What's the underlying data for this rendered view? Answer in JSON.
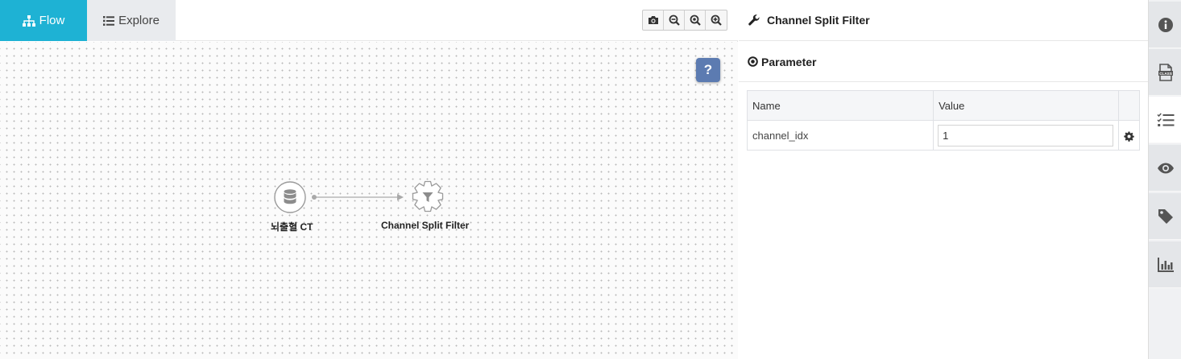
{
  "tabs": [
    {
      "label": "Flow",
      "icon": "sitemap-icon",
      "active": true
    },
    {
      "label": "Explore",
      "icon": "list-icon",
      "active": false
    }
  ],
  "toolbar": {
    "buttons": [
      "camera-icon",
      "zoom-out-icon",
      "zoom-fit-icon",
      "zoom-in-icon"
    ]
  },
  "canvas": {
    "help_label": "?",
    "nodes": [
      {
        "label": "뇌출혈 CT",
        "icon": "database-icon"
      },
      {
        "label": "Channel Split Filter",
        "icon": "filter-gear-icon"
      }
    ]
  },
  "panel": {
    "title": "Channel Split Filter",
    "section": "Parameter",
    "columns": [
      "Name",
      "Value"
    ],
    "params": [
      {
        "name": "channel_idx",
        "value": "1"
      }
    ]
  },
  "sidebar": {
    "buttons": [
      "info-icon",
      "class-file-icon",
      "checklist-icon",
      "eye-icon",
      "tag-icon",
      "bar-chart-icon"
    ],
    "active_index": 2
  },
  "colors": {
    "accent": "#1eb2d4",
    "help": "#5c7bb1"
  }
}
